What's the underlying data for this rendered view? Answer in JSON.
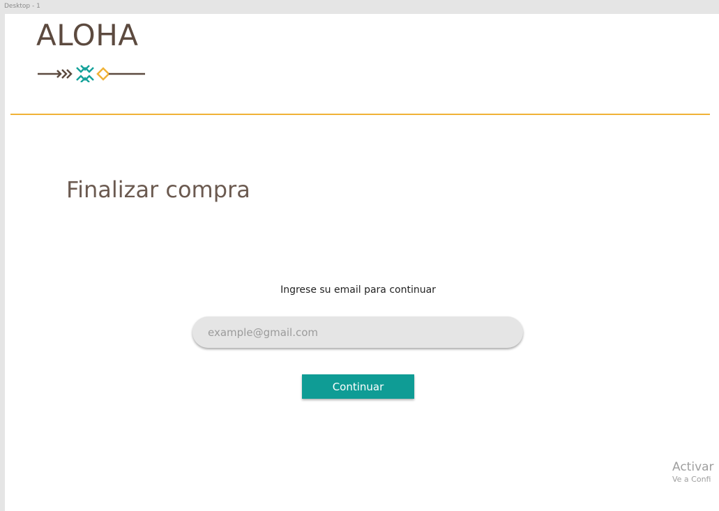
{
  "frame": {
    "label": "Desktop - 1"
  },
  "header": {
    "logo_text": "ALOHA",
    "logo_mark_icon": "arrow-diamond-pattern-icon",
    "accent_color": "#f0b236"
  },
  "main": {
    "title": "Finalizar compra",
    "prompt": "Ingrese su email para continuar",
    "email_placeholder": "example@gmail.com",
    "email_value": "",
    "continue_label": "Continuar",
    "button_color": "#0f9c95"
  },
  "watermark": {
    "title": "Activar",
    "subtitle": "Ve a Confi"
  }
}
